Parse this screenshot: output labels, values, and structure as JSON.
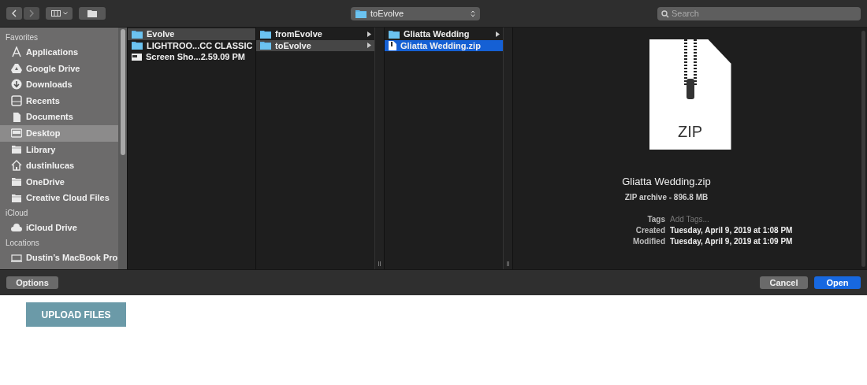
{
  "toolbar": {
    "location": "toEvolve",
    "search": {
      "placeholder": "Search"
    }
  },
  "sidebar": [
    {
      "heading": "Favorites",
      "items": [
        {
          "label": "Applications",
          "selected": false
        },
        {
          "label": "Google Drive",
          "selected": false
        },
        {
          "label": "Downloads",
          "selected": false
        },
        {
          "label": "Recents",
          "selected": false
        },
        {
          "label": "Documents",
          "selected": false
        },
        {
          "label": "Desktop",
          "selected": true
        },
        {
          "label": "Library",
          "selected": false
        },
        {
          "label": "dustinlucas",
          "selected": false
        },
        {
          "label": "OneDrive",
          "selected": false
        },
        {
          "label": "Creative Cloud Files",
          "selected": false
        }
      ]
    },
    {
      "heading": "iCloud",
      "items": [
        {
          "label": "iCloud Drive",
          "selected": false
        }
      ]
    },
    {
      "heading": "Locations",
      "items": [
        {
          "label": "Dustin’s MacBook Pro",
          "selected": false
        }
      ]
    }
  ],
  "columns": [
    {
      "active": false,
      "items": [
        {
          "kind": "folder",
          "name": "Evolve",
          "selected": true
        },
        {
          "kind": "folder",
          "name": "LIGHTROO...CC CLASSIC",
          "selected": false
        },
        {
          "kind": "image",
          "name": "Screen Sho...2.59.09 PM",
          "selected": false
        }
      ]
    },
    {
      "active": false,
      "items": [
        {
          "kind": "folder",
          "name": "fromEvolve",
          "selected": false
        },
        {
          "kind": "folder",
          "name": "toEvolve",
          "selected": true
        }
      ]
    },
    {
      "active": true,
      "items": [
        {
          "kind": "folder",
          "name": "Gliatta Wedding",
          "selected": false
        },
        {
          "kind": "document",
          "name": "Gliatta Wedding.zip",
          "selected": true
        }
      ]
    }
  ],
  "preview": {
    "icon_label": "ZIP",
    "name": "Gliatta Wedding.zip",
    "info": "ZIP archive - 896.8 MB",
    "fields": [
      {
        "label": "Tags",
        "placeholder": "Add Tags..."
      },
      {
        "label": "Created",
        "value": "Tuesday, April 9, 2019 at 1:08 PM"
      },
      {
        "label": "Modified",
        "value": "Tuesday, April 9, 2019 at 1:09 PM"
      }
    ]
  },
  "footer": {
    "options": "Options",
    "cancel": "Cancel",
    "open": "Open"
  },
  "page": {
    "upload_button": "UPLOAD FILES"
  }
}
